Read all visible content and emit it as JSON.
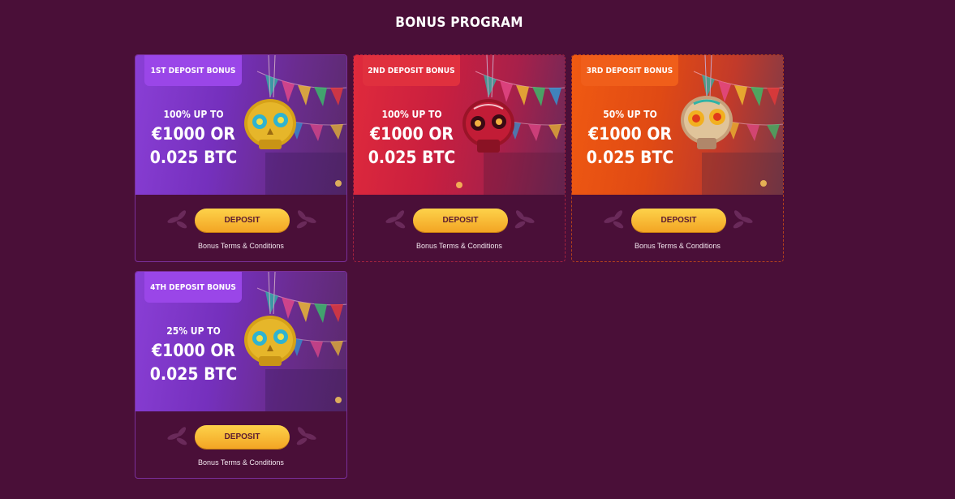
{
  "page": {
    "title": "BONUS PROGRAM"
  },
  "cards": [
    {
      "tag": "1ST DEPOSIT BONUS",
      "pct": "100% UP TO",
      "line1": "€1000 OR",
      "line2": "0.025 BTC",
      "button": "DEPOSIT",
      "terms": "Bonus Terms & Conditions"
    },
    {
      "tag": "2ND DEPOSIT BONUS",
      "pct": "100% UP TO",
      "line1": "€1000 OR",
      "line2": "0.025 BTC",
      "button": "DEPOSIT",
      "terms": "Bonus Terms & Conditions"
    },
    {
      "tag": "3RD DEPOSIT BONUS",
      "pct": "50% UP TO",
      "line1": "€1000 OR",
      "line2": "0.025 BTC",
      "button": "DEPOSIT",
      "terms": "Bonus Terms & Conditions"
    },
    {
      "tag": "4TH DEPOSIT BONUS",
      "pct": "25% UP TO",
      "line1": "€1000 OR",
      "line2": "0.025 BTC",
      "button": "DEPOSIT",
      "terms": "Bonus Terms & Conditions"
    }
  ],
  "icons": {
    "skull": "sugar-skull-icon",
    "flags": "bunting-flags-icon",
    "leaves": "laurel-ornament-icon"
  },
  "colors": {
    "background": "#4a0f38",
    "button": "#f3b134",
    "violet": "#8a3fd6",
    "red": "#e02a3c",
    "orange": "#f05a12"
  }
}
